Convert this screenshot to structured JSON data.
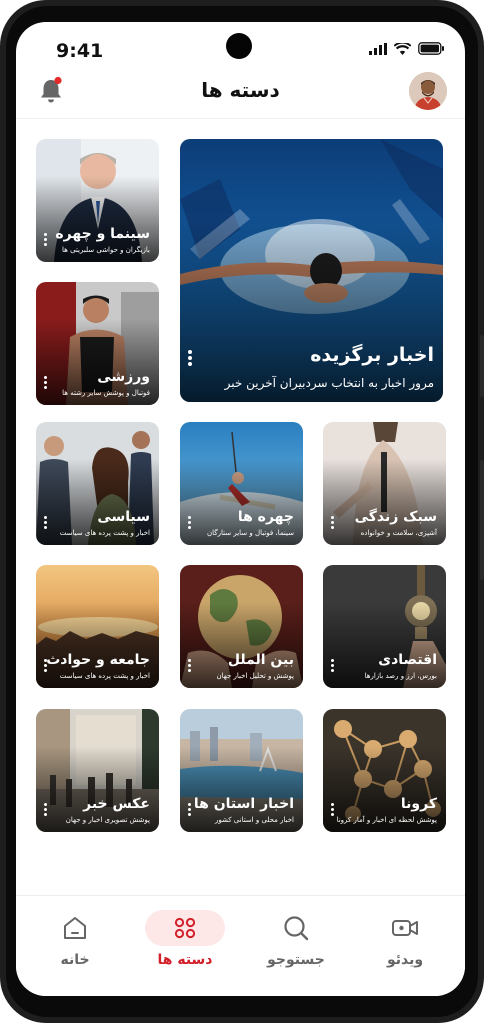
{
  "status_bar": {
    "time": "9:41"
  },
  "header": {
    "title": "دسته ها"
  },
  "colors": {
    "accent": "#d21f2a",
    "notification_dot": "#e52a2a"
  },
  "featured": {
    "title": "اخبار برگزیده",
    "subtitle": "مرور اخبار به انتخاب سردبیران آخرین خبر"
  },
  "categories": [
    {
      "title": "سینما و چهره",
      "subtitle": "بازیگران و حواشی سلبریتی ها"
    },
    {
      "title": "ورزشی",
      "subtitle": "فوتبال و پوشش سایر رشته ها"
    },
    {
      "title": "سبک زندگی",
      "subtitle": "آشپزی، سلامت و خوانواده"
    },
    {
      "title": "چهره ها",
      "subtitle": "سینما، فوتبال و سایر ستارگان"
    },
    {
      "title": "سیاسی",
      "subtitle": "اخبار و پشت پرده های سیاست"
    },
    {
      "title": "اقتصادی",
      "subtitle": "بورس، ارز و رصد بازارها"
    },
    {
      "title": "بین الملل",
      "subtitle": "پوشش و تحلیل اخبار جهان"
    },
    {
      "title": "جامعه و حوادث",
      "subtitle": "اخبار و پشت پرده های سیاست"
    },
    {
      "title": "کرونا",
      "subtitle": "پوشش لحظه ای اخبار و آمار کرونا"
    },
    {
      "title": "اخبار استان ها",
      "subtitle": "اخبار محلی و استانی کشور"
    },
    {
      "title": "عکس خبر",
      "subtitle": "پوشش تصویری اخبار و جهان"
    }
  ],
  "bottom_nav": [
    {
      "label": "ویدئو",
      "icon": "video-icon"
    },
    {
      "label": "جستوجو",
      "icon": "search-icon"
    },
    {
      "label": "دسته ها",
      "icon": "categories-icon",
      "active": true
    },
    {
      "label": "خانه",
      "icon": "home-icon"
    }
  ]
}
